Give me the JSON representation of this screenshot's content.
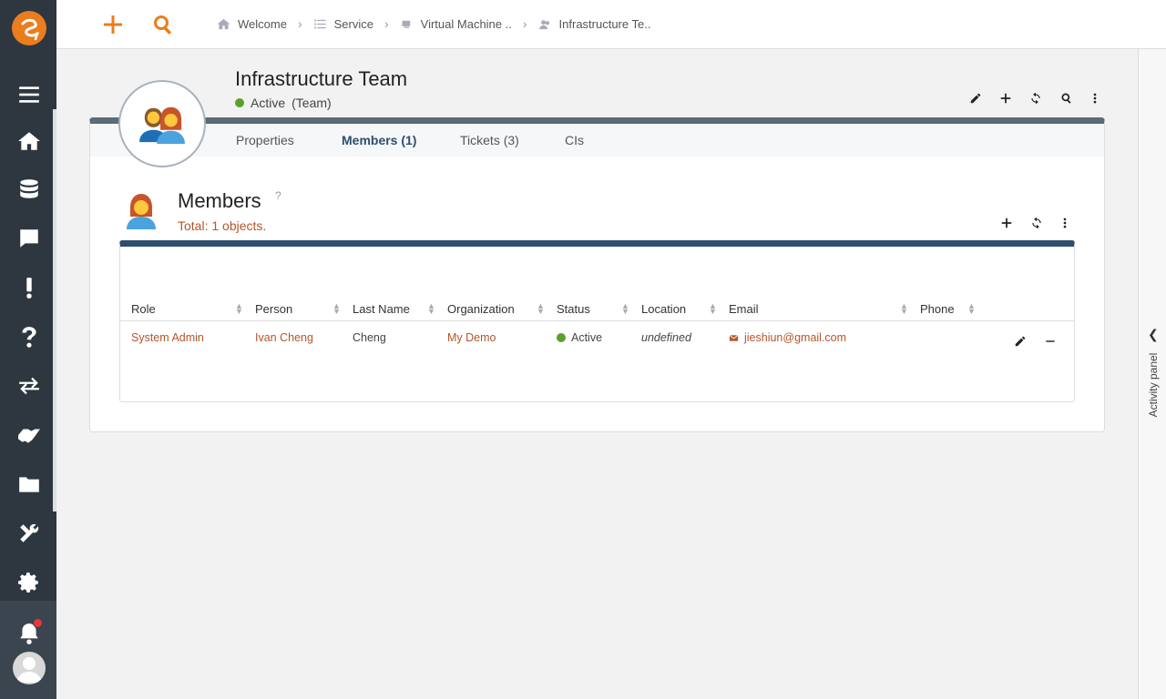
{
  "breadcrumbs": [
    "Welcome",
    "Service",
    "Virtual Machine ..",
    "Infrastructure Te.."
  ],
  "team": {
    "name": "Infrastructure Team",
    "status": "Active",
    "type": "(Team)"
  },
  "tabs": [
    "Properties",
    "Members (1)",
    "Tickets (3)",
    "CIs"
  ],
  "members": {
    "title": "Members",
    "help": "?",
    "total": "Total: 1 objects.",
    "columns": [
      "Role",
      "Person",
      "Last Name",
      "Organization",
      "Status",
      "Location",
      "Email",
      "Phone"
    ],
    "rows": [
      {
        "role": "System Admin",
        "person": "Ivan Cheng",
        "last_name": "Cheng",
        "organization": "My Demo",
        "status": "Active",
        "location": "undefined",
        "email": "jieshiun@gmail.com",
        "phone": ""
      }
    ]
  },
  "activity_panel": {
    "label": "Activity panel"
  },
  "colors": {
    "accent": "#ea7d1e",
    "link": "#b5552a",
    "nav": "#2e3740",
    "header_bar": "#2d4e6e",
    "status_active": "#5aa02c"
  },
  "icons": {
    "nav": [
      "home-icon",
      "database-icon",
      "chat-icon",
      "alert-icon",
      "help-icon",
      "exchange-icon",
      "handshake-icon",
      "folder-icon",
      "tools-icon",
      "settings-icon",
      "bell-icon",
      "user-avatar"
    ]
  }
}
